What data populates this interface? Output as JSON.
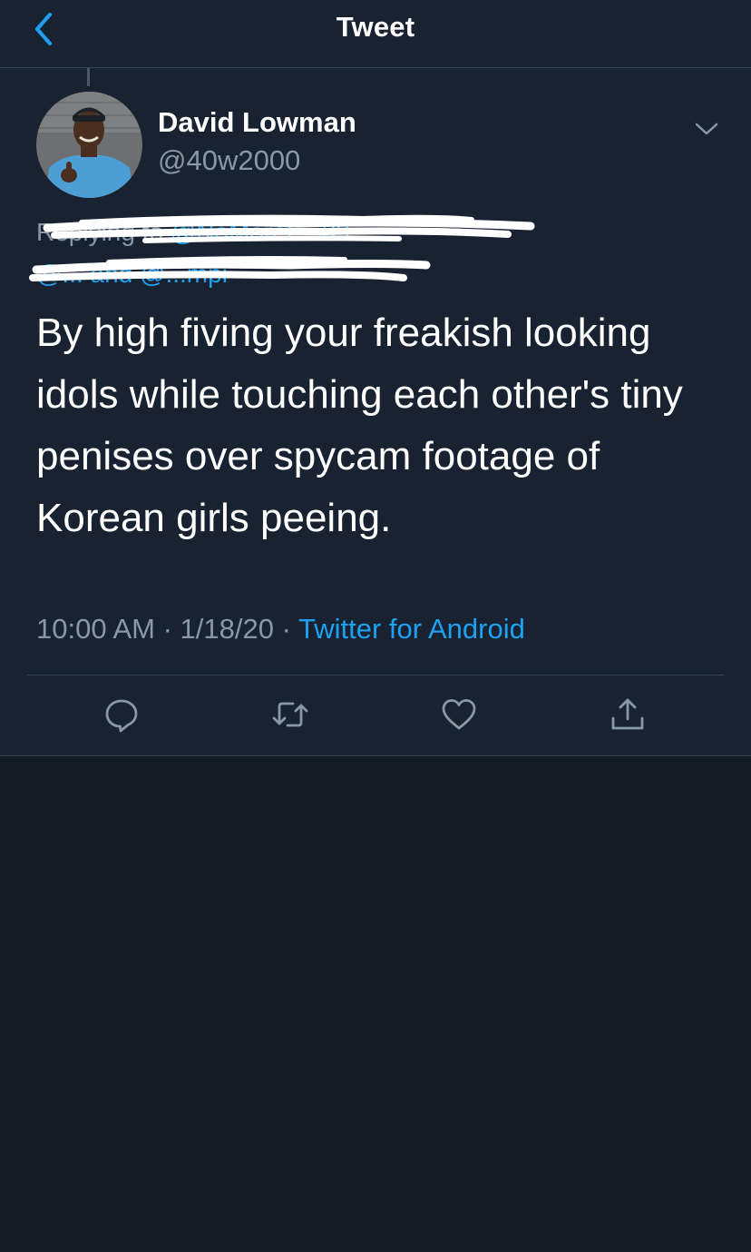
{
  "header": {
    "title": "Tweet",
    "back_icon": "chevron-left-icon"
  },
  "tweet": {
    "author": {
      "display_name": "David Lowman",
      "handle": "@40w2000",
      "avatar_icon": "user-avatar"
    },
    "reply_context": {
      "line1_prefix": "Replying to ",
      "line1_mentions": "@NoMoreL...09",
      "line2_mentions": "@... and @...mpi"
    },
    "text": "By high fiving your freakish looking idols while touching each other's tiny penises over spycam footage of Korean girls peeing.",
    "time": "10:00 AM",
    "separator": " · ",
    "date": "1/18/20",
    "source": "Twitter for Android",
    "actions": {
      "reply_icon": "comment-icon",
      "retweet_icon": "retweet-icon",
      "like_icon": "heart-icon",
      "share_icon": "share-icon"
    }
  },
  "colors": {
    "background": "#141a22",
    "card": "#192230",
    "accent": "#1da1f2",
    "secondary_text": "#8899a6",
    "border": "#38444d"
  }
}
